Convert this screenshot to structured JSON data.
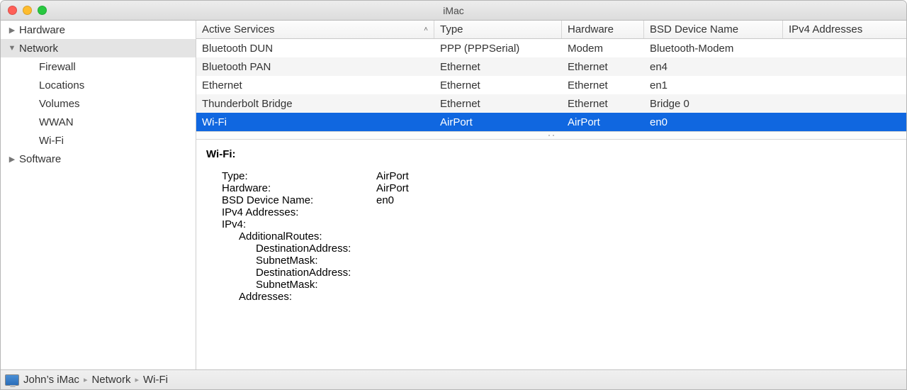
{
  "window": {
    "title": "iMac"
  },
  "sidebar": {
    "items": [
      {
        "label": "Hardware",
        "expanded": false,
        "level": 0
      },
      {
        "label": "Network",
        "expanded": true,
        "level": 0,
        "selected": true
      },
      {
        "label": "Firewall",
        "level": 1
      },
      {
        "label": "Locations",
        "level": 1
      },
      {
        "label": "Volumes",
        "level": 1
      },
      {
        "label": "WWAN",
        "level": 1
      },
      {
        "label": "Wi-Fi",
        "level": 1
      },
      {
        "label": "Software",
        "expanded": false,
        "level": 0
      }
    ]
  },
  "table": {
    "columns": [
      {
        "label": "Active Services",
        "sorted": true
      },
      {
        "label": "Type"
      },
      {
        "label": "Hardware"
      },
      {
        "label": "BSD Device Name"
      },
      {
        "label": "IPv4 Addresses"
      }
    ],
    "rows": [
      {
        "service": "Bluetooth DUN",
        "type": "PPP (PPPSerial)",
        "hw": "Modem",
        "bsd": "Bluetooth-Modem",
        "ipv4": ""
      },
      {
        "service": "Bluetooth PAN",
        "type": "Ethernet",
        "hw": "Ethernet",
        "bsd": "en4",
        "ipv4": ""
      },
      {
        "service": "Ethernet",
        "type": "Ethernet",
        "hw": "Ethernet",
        "bsd": "en1",
        "ipv4": ""
      },
      {
        "service": "Thunderbolt Bridge",
        "type": "Ethernet",
        "hw": "Ethernet",
        "bsd": "Bridge 0",
        "ipv4": ""
      },
      {
        "service": "Wi-Fi",
        "type": "AirPort",
        "hw": "AirPort",
        "bsd": "en0",
        "ipv4": "",
        "selected": true
      }
    ]
  },
  "detail": {
    "title": "Wi-Fi:",
    "rows": [
      {
        "key": "Type:",
        "val": "AirPort"
      },
      {
        "key": "Hardware:",
        "val": "AirPort"
      },
      {
        "key": "BSD Device Name:",
        "val": "en0"
      },
      {
        "key": "IPv4 Addresses:",
        "val": ""
      },
      {
        "key": "IPv4:",
        "val": ""
      }
    ],
    "nested": [
      {
        "label": "AdditionalRoutes:",
        "level": 1
      },
      {
        "label": "DestinationAddress:",
        "level": 2
      },
      {
        "label": "SubnetMask:",
        "level": 2
      },
      {
        "label": "DestinationAddress:",
        "level": 2
      },
      {
        "label": "SubnetMask:",
        "level": 2
      },
      {
        "label": "Addresses:",
        "level": 1
      }
    ]
  },
  "pathbar": {
    "items": [
      "John’s iMac",
      "Network",
      "Wi-Fi"
    ]
  }
}
